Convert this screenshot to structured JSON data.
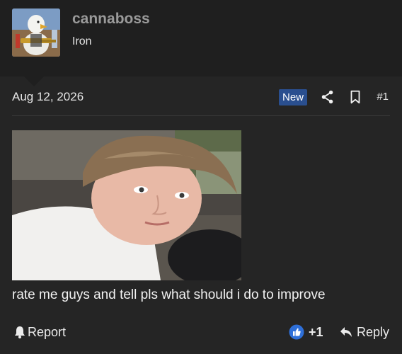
{
  "author": {
    "username": "cannaboss",
    "user_title": "Iron",
    "avatar_icon": "avatar-eagle-icon"
  },
  "post": {
    "date": "Aug 12, 2026",
    "badge": "New",
    "number": "#1",
    "text": "rate me guys and tell pls what should i do to improve"
  },
  "actions": {
    "report_label": "Report",
    "like_count": "+1",
    "reply_label": "Reply"
  },
  "colors": {
    "background": "#252525",
    "header": "#1f1f1f",
    "badge": "#2a4f8f",
    "like": "#2e6fd8"
  }
}
